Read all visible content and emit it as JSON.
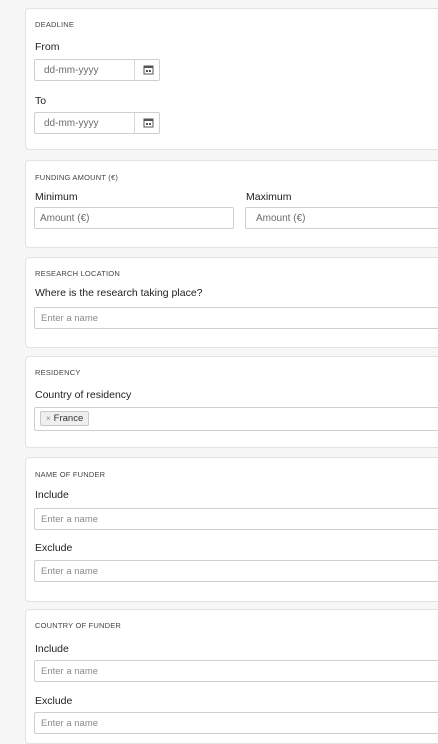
{
  "deadline": {
    "title": "DEADLINE",
    "from_label": "From",
    "from_placeholder": "dd-mm-yyyy",
    "to_label": "To",
    "to_placeholder": "dd-mm-yyyy",
    "calendar_icon": "calendar-icon"
  },
  "funding": {
    "title": "FUNDING AMOUNT (€)",
    "min_label": "Minimum",
    "min_placeholder": "Amount (€)",
    "max_label": "Maximum",
    "max_placeholder": "Amount (€)"
  },
  "research_location": {
    "title": "RESEARCH LOCATION",
    "question": "Where is the research taking place?",
    "placeholder": "Enter a name"
  },
  "residency": {
    "title": "RESIDENCY",
    "label": "Country of residency",
    "chip_remove": "×",
    "chip_value": "France"
  },
  "funder_name": {
    "title": "NAME OF FUNDER",
    "include_label": "Include",
    "include_placeholder": "Enter a name",
    "exclude_label": "Exclude",
    "exclude_placeholder": "Enter a name"
  },
  "funder_country": {
    "title": "COUNTRY OF FUNDER",
    "include_label": "Include",
    "include_placeholder": "Enter a name",
    "exclude_label": "Exclude",
    "exclude_placeholder": "Enter a name"
  }
}
